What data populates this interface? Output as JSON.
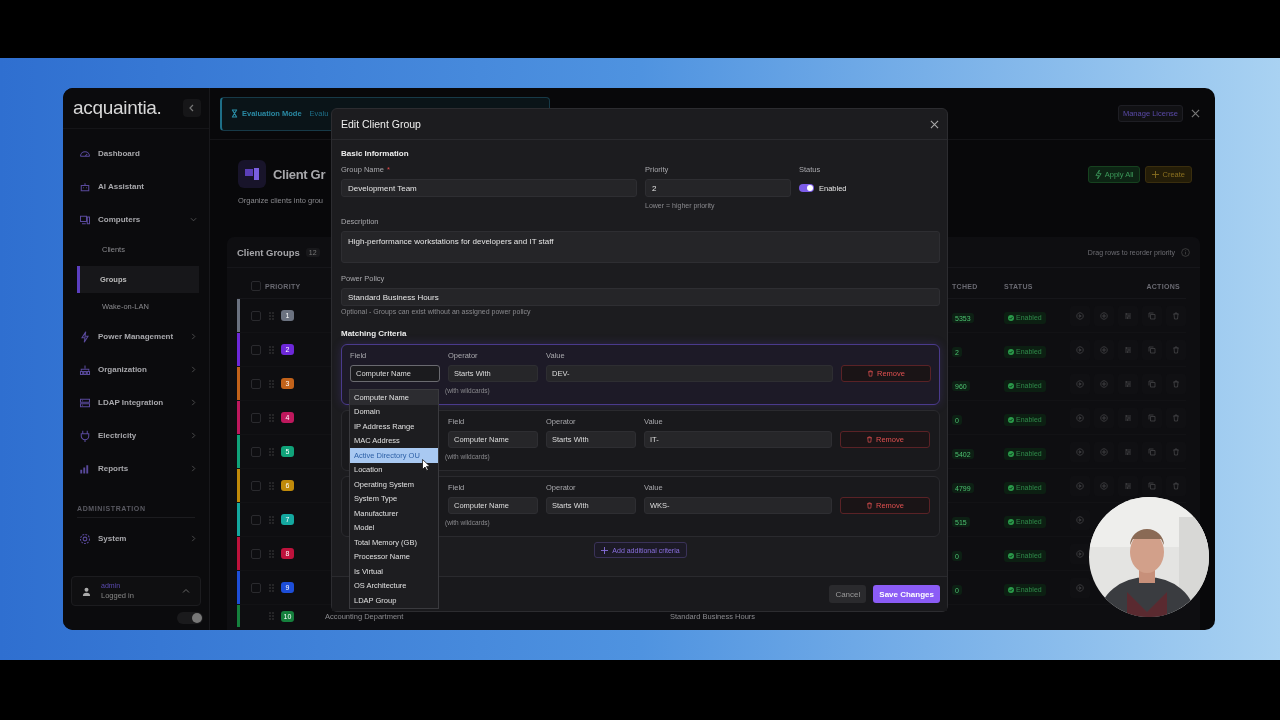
{
  "sidebar": {
    "logo": "acquaintia.",
    "items": [
      {
        "label": "Dashboard",
        "selected": false
      },
      {
        "label": "AI Assistant",
        "selected": false
      },
      {
        "label": "Computers",
        "selected": false,
        "expanded": true,
        "children": [
          {
            "label": "Clients",
            "selected": false
          },
          {
            "label": "Groups",
            "selected": true
          },
          {
            "label": "Wake-on-LAN",
            "selected": false
          }
        ]
      },
      {
        "label": "Power Management",
        "selected": false,
        "expanded": false
      },
      {
        "label": "Organization",
        "selected": false,
        "expanded": false
      },
      {
        "label": "LDAP Integration",
        "selected": false,
        "expanded": false
      },
      {
        "label": "Electricity",
        "selected": false,
        "expanded": false
      },
      {
        "label": "Reports",
        "selected": false,
        "expanded": false
      }
    ],
    "section_label": "ADMINISTRATION",
    "admin_items": [
      {
        "label": "System",
        "selected": false,
        "expanded": false
      }
    ],
    "user": {
      "name": "admin",
      "status": "Logged in"
    },
    "theme_toggle": {
      "on": true
    }
  },
  "header": {
    "banner_title": "Evaluation Mode",
    "banner_text": "Evalu",
    "manage_license": "Manage License"
  },
  "page": {
    "title": "Client Gr",
    "subtitle": "Organize clients into grou",
    "buttons": [
      {
        "label": "Apply All",
        "kind": "apply"
      },
      {
        "label": "Create",
        "kind": "create"
      }
    ]
  },
  "table": {
    "title": "Client Groups",
    "count": "12",
    "hint": "Drag rows to reorder priority",
    "select_all_checked": false,
    "columns": {
      "priority": "PRIORITY",
      "matched": "TCHED",
      "status": "STATUS",
      "actions": "ACTIONS"
    },
    "rows": [
      {
        "priority": "1",
        "checked": false,
        "color": "#6b7280",
        "matched": "5353",
        "status": "Enabled"
      },
      {
        "priority": "2",
        "checked": false,
        "color": "#6d28d9",
        "matched": "2",
        "status": "Enabled"
      },
      {
        "priority": "3",
        "checked": false,
        "color": "#c2621a",
        "matched": "960",
        "status": "Enabled"
      },
      {
        "priority": "4",
        "checked": false,
        "color": "#be185d",
        "matched": "0",
        "status": "Enabled"
      },
      {
        "priority": "5",
        "checked": false,
        "color": "#10a37a",
        "matched": "5402",
        "status": "Enabled"
      },
      {
        "priority": "6",
        "checked": false,
        "color": "#c08a0a",
        "matched": "4799",
        "status": "Enabled"
      },
      {
        "priority": "7",
        "checked": false,
        "color": "#14a8a0",
        "matched": "515",
        "status": "Enabled"
      },
      {
        "priority": "8",
        "checked": false,
        "color": "#be123c",
        "matched": "0",
        "status": "Enabled"
      },
      {
        "priority": "9",
        "checked": false,
        "color": "#1d4ed8",
        "matched": "0",
        "status": "Enabled"
      },
      {
        "priority": "10",
        "color": "#15803d",
        "name": "Accounting Department",
        "policy": "Standard Business Hours"
      }
    ]
  },
  "modal": {
    "title": "Edit Client Group",
    "section_basic": "Basic Information",
    "group_name": {
      "label": "Group Name",
      "required_mark": "*",
      "value": "Development Team"
    },
    "priority": {
      "label": "Priority",
      "value": "2",
      "hint": "Lower = higher priority"
    },
    "status": {
      "label": "Status",
      "on": true,
      "text": "Enabled"
    },
    "description": {
      "label": "Description",
      "value": "High-performance workstations for developers and IT staff"
    },
    "power_policy": {
      "label": "Power Policy",
      "value": "Standard Business Hours",
      "hint": "Optional - Groups can exist without an assigned power policy"
    },
    "section_criteria": "Matching Criteria",
    "criteria": [
      {
        "kind": "first",
        "focused": true,
        "field_label": "Field",
        "field": "Computer Name",
        "operator_label": "Operator",
        "operator": "Starts With",
        "value_label": "Value",
        "value": "DEV-",
        "hint": "(with wildcards)",
        "remove": "Remove"
      },
      {
        "kind": "additional",
        "focused": false,
        "field_label": "Field",
        "field": "Computer Name",
        "operator_label": "Operator",
        "operator": "Starts With",
        "value_label": "Value",
        "value": "IT-",
        "hint": "(with wildcards)",
        "remove": "Remove"
      },
      {
        "kind": "additional",
        "focused": false,
        "field_label": "Field",
        "field": "Computer Name",
        "operator_label": "Operator",
        "operator": "Starts With",
        "value_label": "Value",
        "value": "WKS-",
        "hint": "(with wildcards)",
        "remove": "Remove"
      }
    ],
    "add_criteria": "Add additional criteria",
    "cancel": "Cancel",
    "save": "Save Changes"
  },
  "dropdown": {
    "options": [
      {
        "label": "Computer Name",
        "current": true,
        "selected": false
      },
      {
        "label": "Domain",
        "current": false,
        "selected": false
      },
      {
        "label": "IP Address Range",
        "current": false,
        "selected": false
      },
      {
        "label": "MAC Address",
        "current": false,
        "selected": false
      },
      {
        "label": "Active Directory OU",
        "current": false,
        "selected": true
      },
      {
        "label": "Location",
        "current": false,
        "selected": false
      },
      {
        "label": "Operating System",
        "current": false,
        "selected": false
      },
      {
        "label": "System Type",
        "current": false,
        "selected": false
      },
      {
        "label": "Manufacturer",
        "current": false,
        "selected": false
      },
      {
        "label": "Model",
        "current": false,
        "selected": false
      },
      {
        "label": "Total Memory (GB)",
        "current": false,
        "selected": false
      },
      {
        "label": "Processor Name",
        "current": false,
        "selected": false
      },
      {
        "label": "Is Virtual",
        "current": false,
        "selected": false
      },
      {
        "label": "OS Architecture",
        "current": false,
        "selected": false
      },
      {
        "label": "LDAP Group",
        "current": false,
        "selected": false
      }
    ]
  }
}
